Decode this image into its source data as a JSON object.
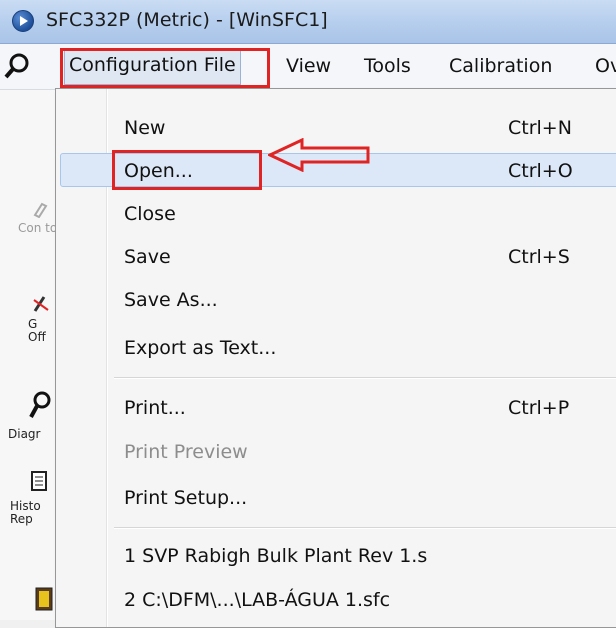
{
  "window": {
    "title": "SFC332P (Metric) - [WinSFC1]"
  },
  "menubar": {
    "items": [
      {
        "label": "Configuration File",
        "active": true
      },
      {
        "label": "View"
      },
      {
        "label": "Tools"
      },
      {
        "label": "Calibration"
      },
      {
        "label": "Ov"
      }
    ]
  },
  "sidebar": {
    "items": [
      {
        "label": "Con\nto De",
        "icon": "connect-icon"
      },
      {
        "label": "G\nOff",
        "icon": "disconnect-icon"
      },
      {
        "label": "Diagr",
        "icon": "magnifier-icon"
      },
      {
        "label": "Histo\nRep",
        "icon": "report-icon"
      },
      {
        "label": "",
        "icon": "book-icon"
      }
    ]
  },
  "dropdown": {
    "items": [
      {
        "label": "New",
        "shortcut": "Ctrl+N"
      },
      {
        "label": "Open...",
        "shortcut": "Ctrl+O",
        "highlighted": true
      },
      {
        "label": "Close",
        "shortcut": ""
      },
      {
        "label": "Save",
        "shortcut": "Ctrl+S"
      },
      {
        "label": "Save As...",
        "shortcut": ""
      },
      {
        "label": "Export as Text...",
        "shortcut": ""
      },
      {
        "label": "Print...",
        "shortcut": "Ctrl+P"
      },
      {
        "label": "Print Preview",
        "shortcut": "",
        "disabled": true
      },
      {
        "label": "Print Setup...",
        "shortcut": ""
      },
      {
        "label": "1 SVP Rabigh Bulk Plant Rev 1.s",
        "shortcut": ""
      },
      {
        "label": "2 C:\\DFM\\...\\LAB-ÁGUA 1.sfc",
        "shortcut": ""
      }
    ]
  },
  "annotation": {
    "color": "#e02424",
    "arrow_icon": "left-arrow-icon"
  }
}
